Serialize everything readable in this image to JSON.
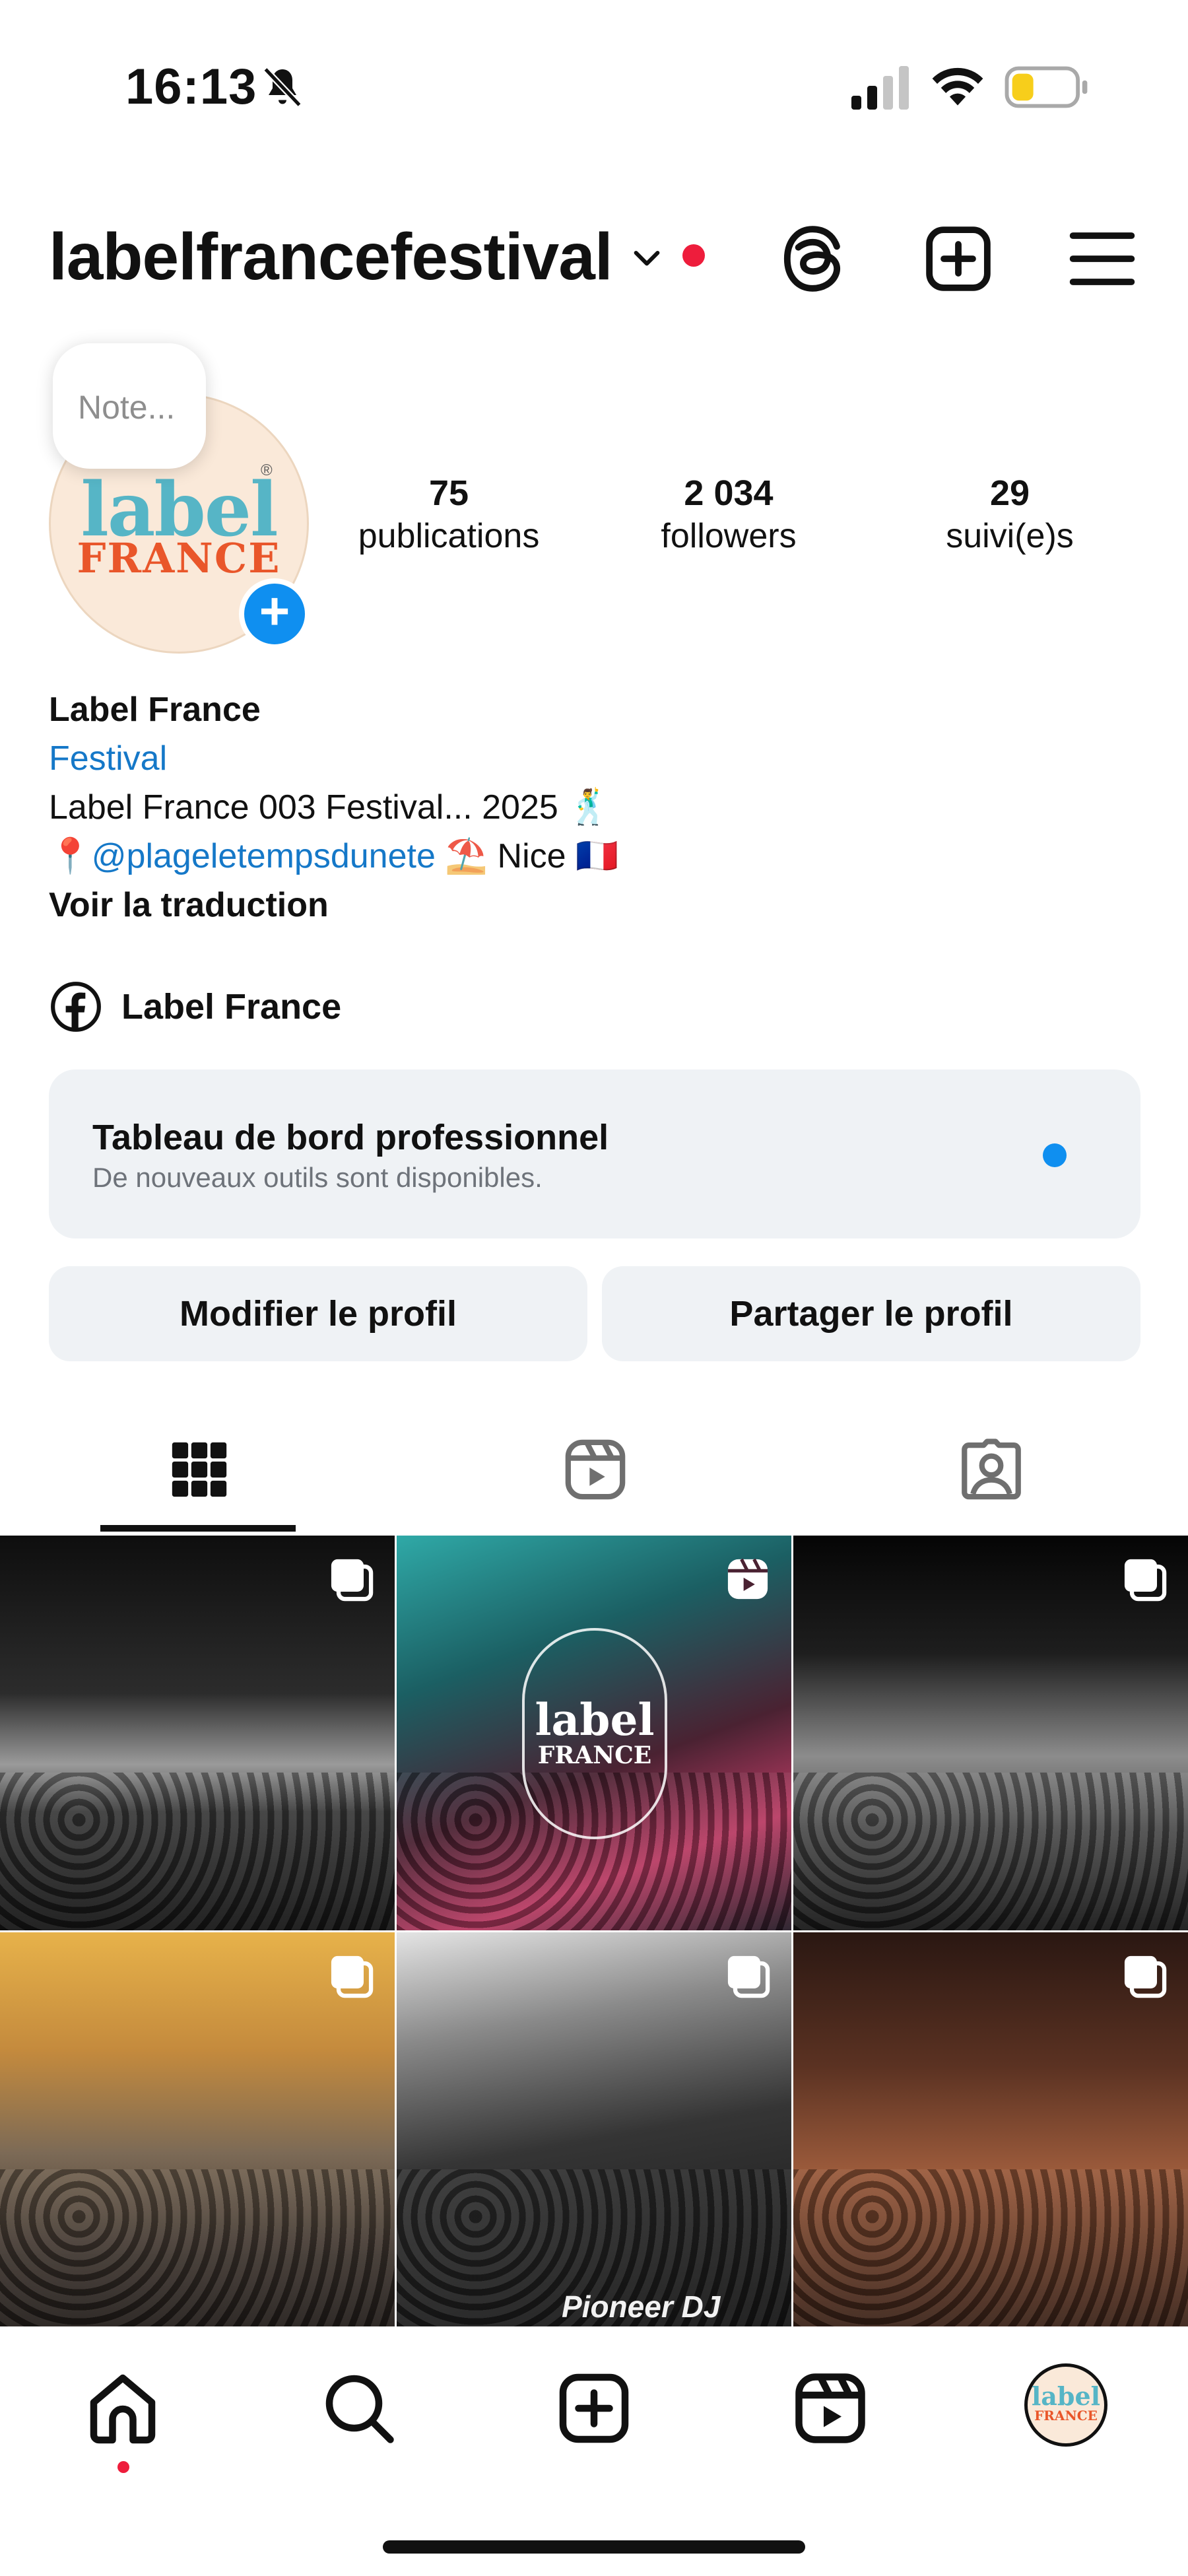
{
  "status_bar": {
    "time": "16:13"
  },
  "header": {
    "username": "labelfrancefestival"
  },
  "profile": {
    "avatar_text_top": "label",
    "avatar_text_bottom": "FRANCE",
    "avatar_reg": "®",
    "note_placeholder": "Note...",
    "add_story_label": "+",
    "stats": [
      {
        "value": "75",
        "label": "publications"
      },
      {
        "value": "2 034",
        "label": "followers"
      },
      {
        "value": "29",
        "label": "suivi(e)s"
      }
    ]
  },
  "bio": {
    "name": "Label France",
    "category": "Festival",
    "line1": "Label France 003 Festival... 2025 🕺",
    "location_pin": "📍",
    "mention": "@plageletempsdunete",
    "line2_rest": " ⛱️ Nice 🇫🇷",
    "translate": "Voir la traduction"
  },
  "facebook_link": {
    "label": "Label France"
  },
  "dashboard": {
    "title": "Tableau de bord professionnel",
    "subtitle": "De nouveaux outils sont disponibles."
  },
  "buttons": {
    "edit": "Modifier le profil",
    "share": "Partager le profil"
  },
  "tabs": [
    {
      "icon": "grid-icon",
      "active": true
    },
    {
      "icon": "reels-icon",
      "active": false
    },
    {
      "icon": "tagged-icon",
      "active": false
    }
  ],
  "posts": [
    {
      "type": "carousel",
      "icon": "carousel-icon"
    },
    {
      "type": "reel",
      "icon": "reel-icon",
      "overlay_top": "label",
      "overlay_bottom": "FRANCE"
    },
    {
      "type": "carousel",
      "icon": "carousel-icon"
    },
    {
      "type": "carousel",
      "icon": "carousel-icon"
    },
    {
      "type": "carousel",
      "icon": "carousel-icon",
      "brand_text": "Pioneer DJ"
    },
    {
      "type": "carousel",
      "icon": "carousel-icon"
    }
  ],
  "bottom_nav": {
    "profile_text_top": "label",
    "profile_text_bottom": "FRANCE"
  },
  "colors": {
    "link_blue": "#1578c8",
    "accent_blue": "#0f8ff0",
    "notification_red": "#ee1d3c",
    "card_gray": "#eff2f5"
  }
}
